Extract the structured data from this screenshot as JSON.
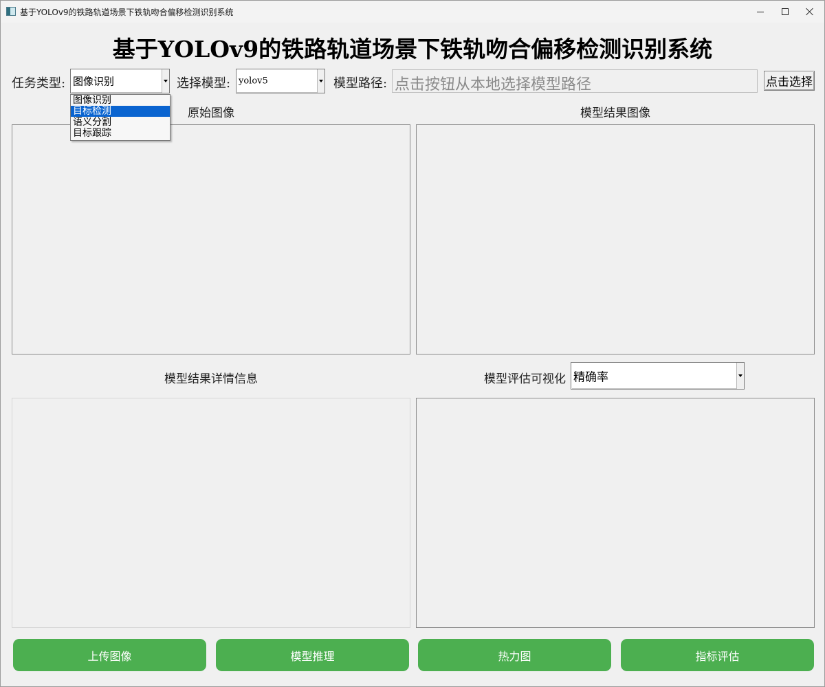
{
  "window": {
    "title": "基于YOLOv9的铁路轨道场景下铁轨吻合偏移检测识别系统"
  },
  "header": {
    "title": "基于YOLOv9的铁路轨道场景下铁轨吻合偏移检测识别系统"
  },
  "toolbar": {
    "task_type_label": "任务类型:",
    "task_type_value": "图像识别",
    "task_type_options": [
      "图像识别",
      "目标检测",
      "语义分割",
      "目标跟踪"
    ],
    "task_type_highlighted": "目标检测",
    "model_label": "选择模型:",
    "model_value": "yolov5",
    "model_path_label": "模型路径:",
    "model_path_placeholder": "点击按钮从本地选择模型路径",
    "select_button_label": "点击选择"
  },
  "sections": {
    "original_image": "原始图像",
    "result_image": "模型结果图像",
    "result_details": "模型结果详情信息",
    "eval_visual_label": "模型评估可视化",
    "eval_metric_value": "精确率"
  },
  "actions": {
    "upload": "上传图像",
    "infer": "模型推理",
    "heatmap": "热力图",
    "evaluate": "指标评估"
  },
  "colors": {
    "accent_green": "#4caf50",
    "selection_blue": "#0a64d0",
    "background": "#f0f0f0"
  },
  "icons": {
    "app": "app-icon",
    "minimize": "minimize-icon",
    "maximize": "maximize-icon",
    "close": "close-icon",
    "dropdown": "chevron-down-icon"
  }
}
